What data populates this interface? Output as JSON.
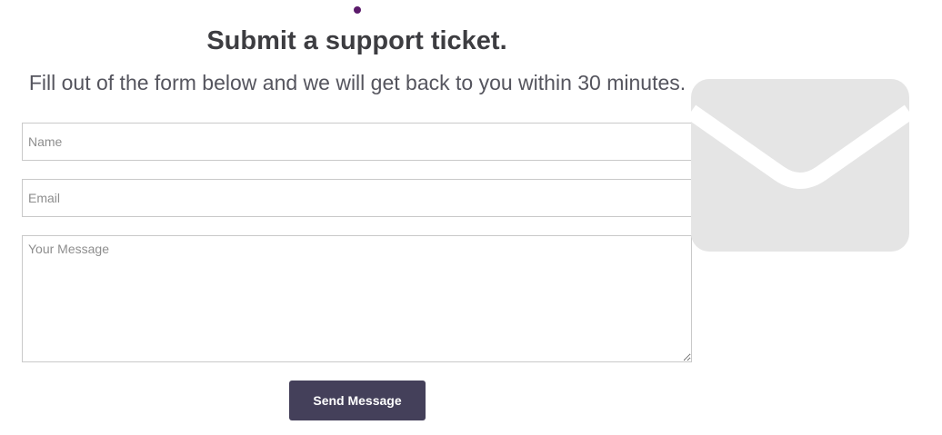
{
  "header": {
    "title": "Submit a support ticket.",
    "subtitle": "Fill out of the form below and we will get back to you within 30 minutes."
  },
  "form": {
    "name": {
      "placeholder": "Name",
      "value": ""
    },
    "email": {
      "placeholder": "Email",
      "value": ""
    },
    "message": {
      "placeholder": "Your Message",
      "value": ""
    },
    "submit_label": "Send Message"
  },
  "decor": {
    "envelope_icon": "envelope-icon",
    "envelope_color": "#e5e5e5",
    "accent_color": "#5b1a6b",
    "button_color": "#44405a"
  }
}
